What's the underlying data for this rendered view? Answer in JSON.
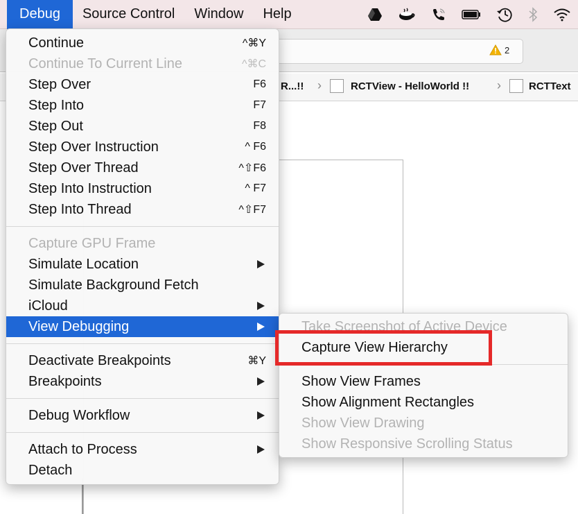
{
  "menubar": {
    "items": [
      {
        "label": "Debug",
        "active": true
      },
      {
        "label": "Source Control"
      },
      {
        "label": "Window"
      },
      {
        "label": "Help"
      }
    ],
    "status_icons": [
      "drive-icon",
      "coffee-cup-icon",
      "phone-icon",
      "battery-icon",
      "time-machine-icon",
      "bluetooth-icon",
      "wifi-icon"
    ]
  },
  "window": {
    "warning_count": "2",
    "jumpbar": {
      "crumb_1": "R...!!",
      "crumb_2": "RCTView - HelloWorld !!",
      "crumb_3": "RCTText"
    }
  },
  "debug_menu": {
    "groups": [
      [
        {
          "label": "Continue",
          "shortcut": "^⌘Y"
        },
        {
          "label": "Continue To Current Line",
          "shortcut": "^⌘C",
          "disabled": true
        },
        {
          "label": "Step Over",
          "shortcut": "F6"
        },
        {
          "label": "Step Into",
          "shortcut": "F7"
        },
        {
          "label": "Step Out",
          "shortcut": "F8"
        },
        {
          "label": "Step Over Instruction",
          "shortcut": "^ F6"
        },
        {
          "label": "Step Over Thread",
          "shortcut": "^⇧F6"
        },
        {
          "label": "Step Into Instruction",
          "shortcut": "^ F7"
        },
        {
          "label": "Step Into Thread",
          "shortcut": "^⇧F7"
        }
      ],
      [
        {
          "label": "Capture GPU Frame",
          "disabled": true
        },
        {
          "label": "Simulate Location",
          "submenu": true
        },
        {
          "label": "Simulate Background Fetch"
        },
        {
          "label": "iCloud",
          "submenu": true
        },
        {
          "label": "View Debugging",
          "submenu": true,
          "highlighted": true
        }
      ],
      [
        {
          "label": "Deactivate Breakpoints",
          "shortcut": "⌘Y"
        },
        {
          "label": "Breakpoints",
          "submenu": true
        }
      ],
      [
        {
          "label": "Debug Workflow",
          "submenu": true
        }
      ],
      [
        {
          "label": "Attach to Process",
          "submenu": true
        },
        {
          "label": "Detach"
        }
      ]
    ]
  },
  "view_debugging_submenu": {
    "groups": [
      [
        {
          "label": "Take Screenshot of Active Device",
          "disabled": true
        },
        {
          "label": "Capture View Hierarchy",
          "emphasized": true
        }
      ],
      [
        {
          "label": "Show View Frames"
        },
        {
          "label": "Show Alignment Rectangles"
        },
        {
          "label": "Show View Drawing",
          "disabled": true
        },
        {
          "label": "Show Responsive Scrolling Status",
          "disabled": true
        }
      ]
    ]
  },
  "colors": {
    "menubar_bg": "#f3e6e8",
    "highlight": "#1f67d6",
    "emphasis_box": "#e52929",
    "disabled_text": "#b3b3b3",
    "warning": "#f4b400"
  }
}
